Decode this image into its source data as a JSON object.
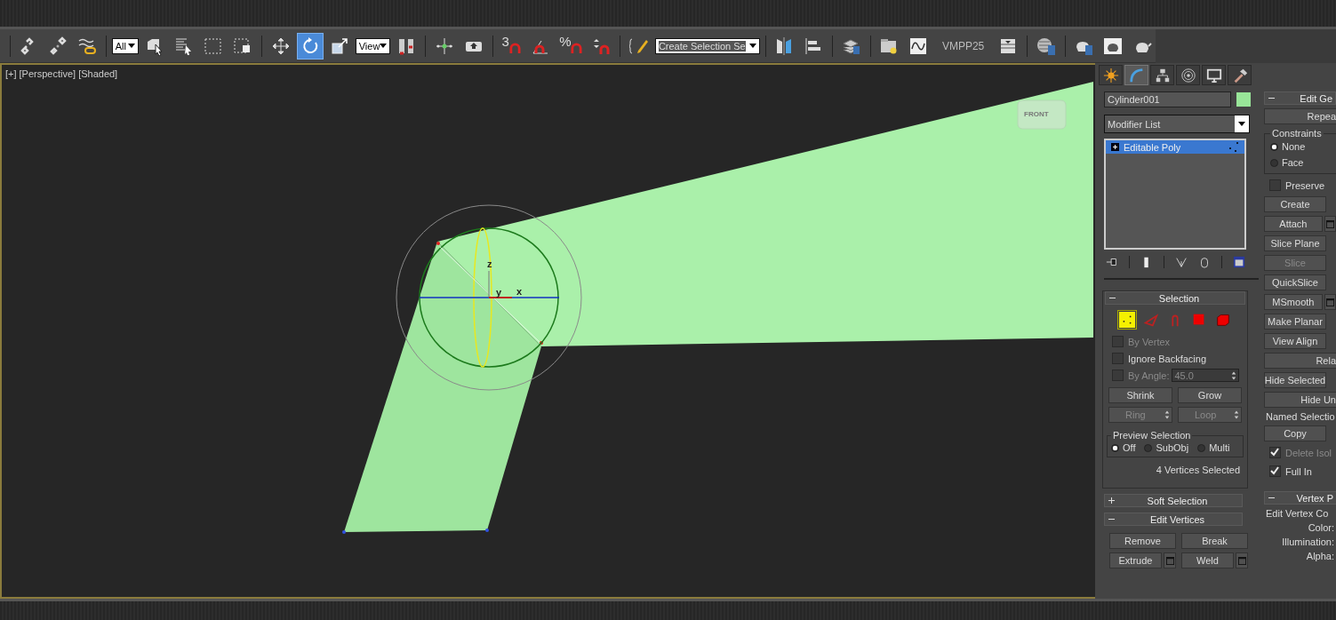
{
  "toolbar": {
    "selection_filter": "All",
    "transform_tools": [
      {
        "selected": false
      },
      {
        "selected": true
      },
      {
        "selected": false
      }
    ],
    "reference_coord": "View",
    "snap_3d_label": "3",
    "percent_snap_label": "%",
    "named_selection": "Create Selection Se",
    "script_label": "VMPP25"
  },
  "viewport": {
    "labels": [
      "[+]",
      "[Perspective]",
      "[Shaded]"
    ],
    "viewcube_label": "FRONT",
    "gizmo_axes": [
      "z",
      "y",
      "x"
    ]
  },
  "command_panel": {
    "tabs": [
      {
        "selected": false
      },
      {
        "selected": true
      },
      {
        "selected": false
      },
      {
        "selected": false
      },
      {
        "selected": false
      },
      {
        "selected": false
      }
    ],
    "object_name": "Cylinder001",
    "modifier_list": "Modifier List",
    "stack": [
      {
        "label": "Editable Poly",
        "selected": true
      }
    ],
    "selection": {
      "title": "Selection",
      "expanded": true,
      "levels": [
        {
          "selected": true
        },
        {
          "selected": false
        },
        {
          "selected": false
        },
        {
          "selected": false
        },
        {
          "selected": false
        }
      ],
      "options": [
        {
          "label": "By Vertex",
          "checked": false,
          "disabled": true
        },
        {
          "label": "Ignore Backfacing",
          "checked": false,
          "disabled": false
        }
      ],
      "by_angle": {
        "label": "By Angle:",
        "checked": false,
        "value": "45.0"
      },
      "buttons": [
        {
          "label": "Shrink",
          "spinner": false,
          "disabled": false
        },
        {
          "label": "Grow",
          "spinner": false,
          "disabled": false
        },
        {
          "label": "Ring",
          "spinner": true,
          "disabled": true
        },
        {
          "label": "Loop",
          "spinner": true,
          "disabled": true
        }
      ],
      "preview": {
        "title": "Preview Selection",
        "options": [
          {
            "label": "Off",
            "selected": true
          },
          {
            "label": "SubObj",
            "selected": false
          },
          {
            "label": "Multi",
            "selected": false
          }
        ]
      },
      "status": "4 Vertices Selected"
    },
    "soft_selection": {
      "title": "Soft Selection",
      "expanded": false
    },
    "edit_vertices": {
      "title": "Edit Vertices",
      "expanded": true,
      "buttons": [
        {
          "label": "Remove",
          "settings": false
        },
        {
          "label": "Break",
          "settings": false
        },
        {
          "label": "Extrude",
          "settings": true
        },
        {
          "label": "Weld",
          "settings": true
        }
      ]
    },
    "edit_geometry": {
      "title": "Edit Ge",
      "expanded": true,
      "items": [
        {
          "kind": "cut_button",
          "label": "Repea"
        },
        {
          "kind": "radio_group",
          "title": "Constraints",
          "options": [
            {
              "label": "None",
              "selected": true
            },
            {
              "label": "Face",
              "selected": false
            }
          ]
        },
        {
          "kind": "checkbox",
          "label": "Preserve",
          "checked": false,
          "disabled": false
        },
        {
          "kind": "button",
          "label": "Create",
          "settings": false,
          "disabled": false
        },
        {
          "kind": "button",
          "label": "Attach",
          "settings": true,
          "disabled": false
        },
        {
          "kind": "button",
          "label": "Slice Plane",
          "settings": false,
          "disabled": false
        },
        {
          "kind": "button",
          "label": "Slice",
          "settings": false,
          "disabled": true
        },
        {
          "kind": "button",
          "label": "QuickSlice",
          "settings": false,
          "disabled": false
        },
        {
          "kind": "button",
          "label": "MSmooth",
          "settings": true,
          "disabled": false
        },
        {
          "kind": "button",
          "label": "Make Planar",
          "settings": false,
          "disabled": false
        },
        {
          "kind": "button",
          "label": "View Align",
          "settings": false,
          "disabled": false
        },
        {
          "kind": "cut_button",
          "label": "Rela"
        },
        {
          "kind": "button",
          "label": "Hide Selected",
          "settings": false,
          "disabled": false
        },
        {
          "kind": "cut_button",
          "label": "Hide Un"
        },
        {
          "kind": "label",
          "label": "Named Selectio"
        },
        {
          "kind": "button",
          "label": "Copy",
          "settings": false,
          "disabled": false
        },
        {
          "kind": "checkbox",
          "label": "Delete Isol",
          "checked": true,
          "disabled": true
        },
        {
          "kind": "checkbox",
          "label": "Full In",
          "checked": true,
          "disabled": false
        }
      ]
    },
    "vertex_properties": {
      "title": "Vertex P",
      "expanded": true,
      "group": "Edit Vertex Co",
      "fields": [
        "Color:",
        "Illumination:",
        "Alpha:"
      ]
    }
  }
}
